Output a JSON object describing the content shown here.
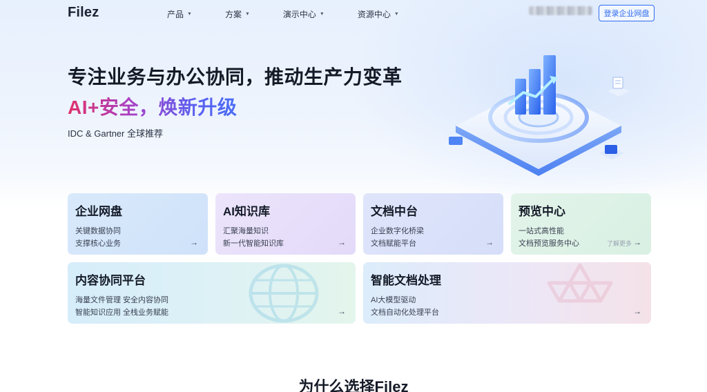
{
  "header": {
    "logo": "Filez",
    "nav": [
      {
        "label": "产品"
      },
      {
        "label": "方案"
      },
      {
        "label": "演示中心"
      },
      {
        "label": "资源中心"
      }
    ],
    "login_button": "登录企业网盘"
  },
  "hero": {
    "title": "专注业务与办公协同，推动生产力变革",
    "subtitle": "AI+安全，焕新升级",
    "note": "IDC & Gartner 全球推荐"
  },
  "cards": [
    {
      "title": "企业网盘",
      "line1": "关键数据协同",
      "line2": "支撑核心业务"
    },
    {
      "title": "AI知识库",
      "line1": "汇聚海量知识",
      "line2": "新一代智能知识库"
    },
    {
      "title": "文档中台",
      "line1": "企业数字化桥梁",
      "line2": "文档赋能平台"
    },
    {
      "title": "预览中心",
      "line1": "一站式高性能",
      "line2": "文档预览服务中心",
      "more": "了解更多"
    },
    {
      "title": "内容协同平台",
      "line1": "海量文件管理 安全内容协同",
      "line2": "智能知识应用 全栈业务赋能"
    },
    {
      "title": "智能文档处理",
      "line1": "AI大模型驱动",
      "line2": "文档自动化处理平台"
    }
  ],
  "section": {
    "why_title": "为什么选择Filez"
  },
  "icons": {
    "arrow": "arrow-right-icon",
    "caret": "chevron-down-icon"
  },
  "colors": {
    "accent": "#2f6bf0",
    "gradient_start": "#e0306a",
    "gradient_end": "#4a6df5"
  }
}
